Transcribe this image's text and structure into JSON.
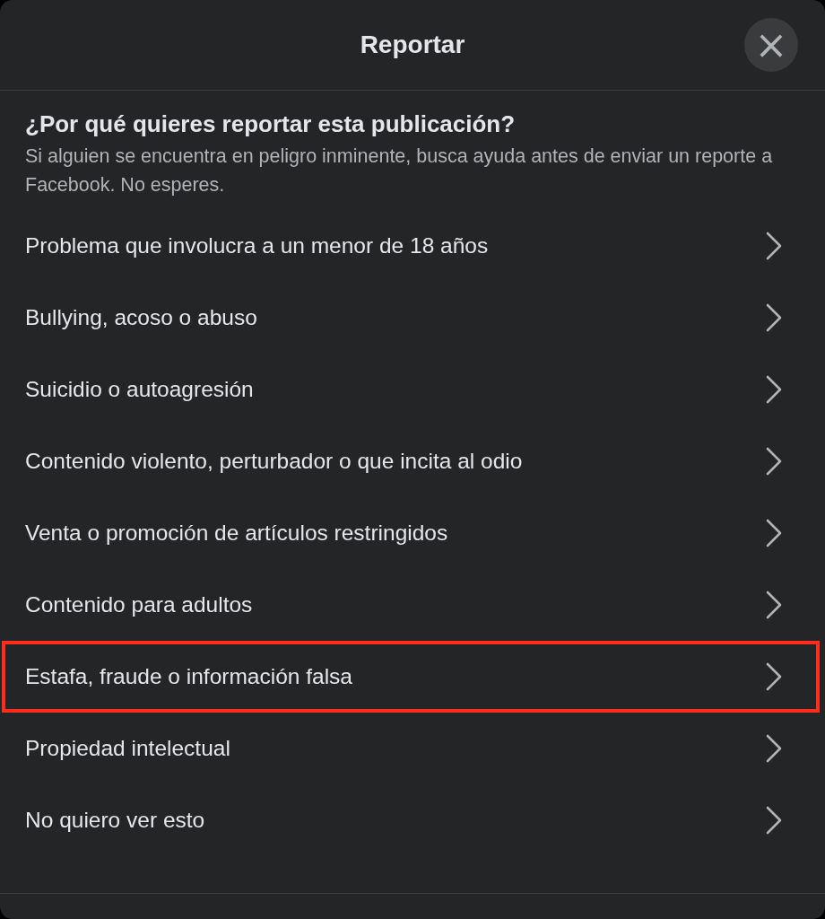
{
  "dialog": {
    "title": "Reportar",
    "close_button": "×"
  },
  "question": {
    "title": "¿Por qué quieres reportar esta publicación?",
    "subtitle": "Si alguien se encuentra en peligro inminente, busca ayuda antes de enviar un reporte a Facebook. No esperes."
  },
  "options": [
    {
      "label": "Problema que involucra a un menor de 18 años",
      "highlighted": false
    },
    {
      "label": "Bullying, acoso o abuso",
      "highlighted": false
    },
    {
      "label": "Suicidio o autoagresión",
      "highlighted": false
    },
    {
      "label": "Contenido violento, perturbador o que incita al odio",
      "highlighted": false
    },
    {
      "label": "Venta o promoción de artículos restringidos",
      "highlighted": false
    },
    {
      "label": "Contenido para adultos",
      "highlighted": false
    },
    {
      "label": "Estafa, fraude o información falsa",
      "highlighted": true
    },
    {
      "label": "Propiedad intelectual",
      "highlighted": false
    },
    {
      "label": "No quiero ver esto",
      "highlighted": false
    }
  ]
}
